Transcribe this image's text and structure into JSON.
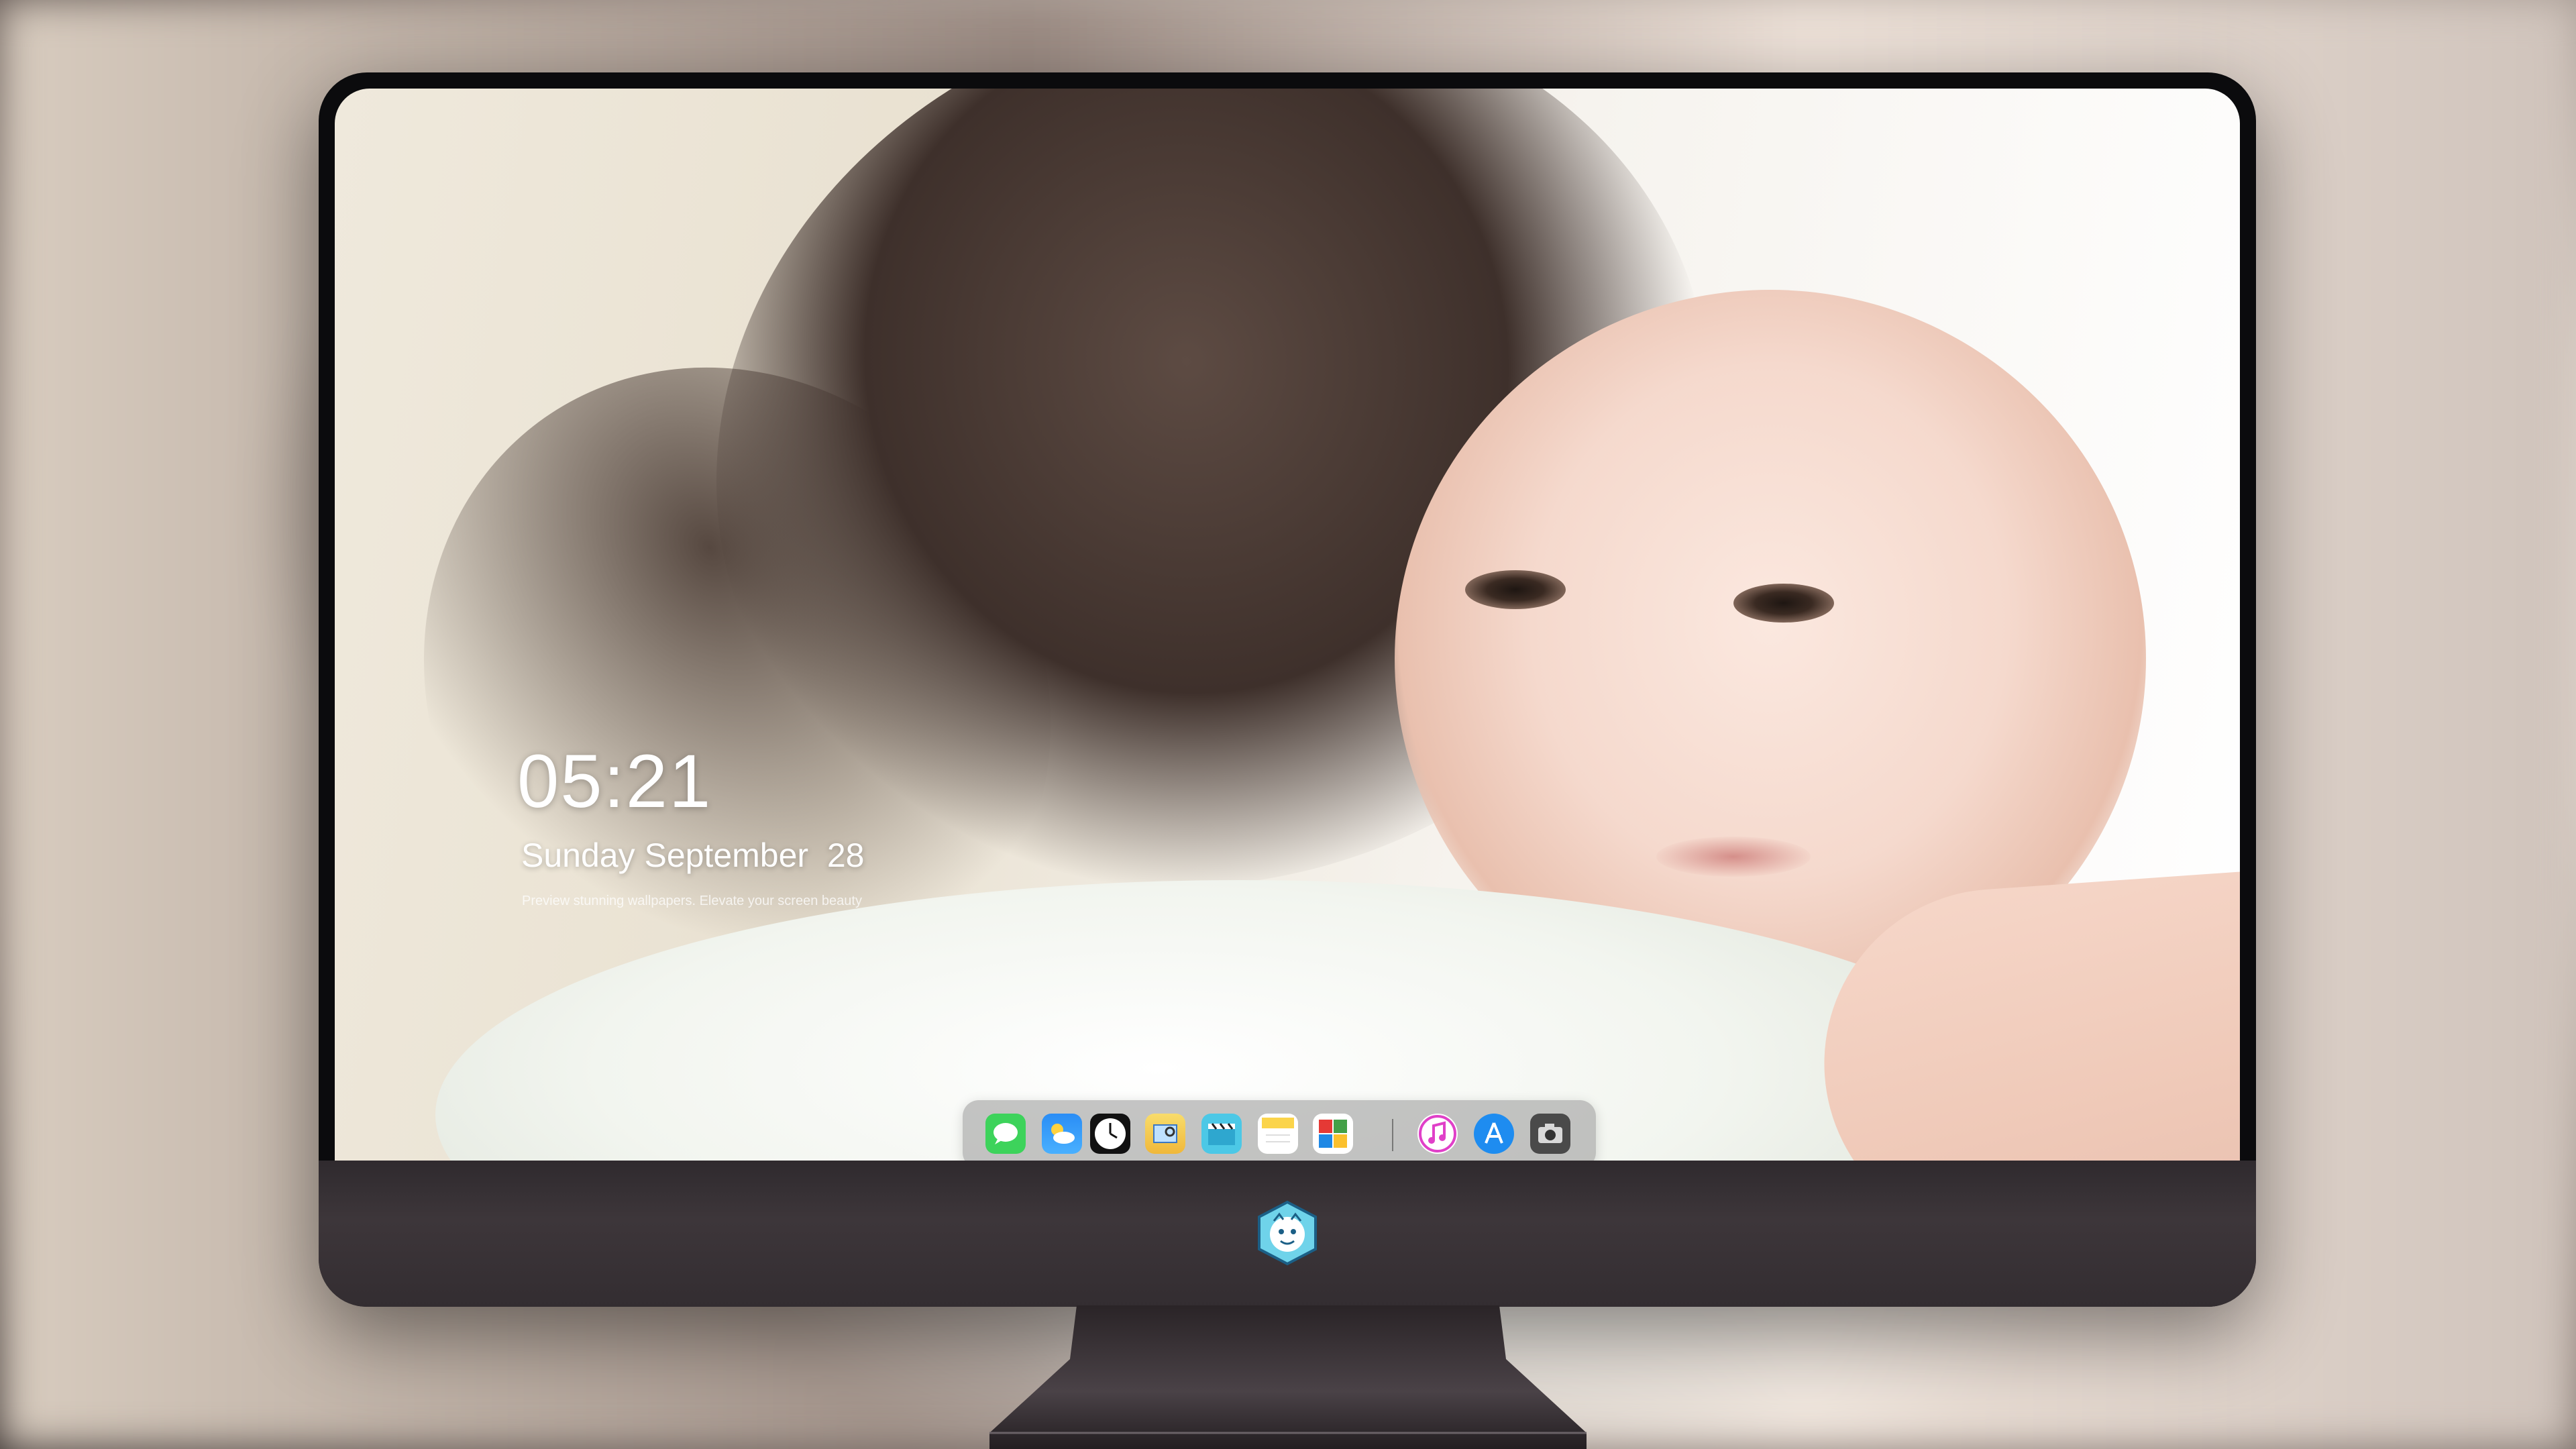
{
  "lockscreen": {
    "time": "05:21",
    "date": "Sunday September  28",
    "caption": "Preview stunning wallpapers. Elevate your screen beauty"
  },
  "dock": {
    "apps": [
      {
        "name": "messages",
        "icon": "chat-bubble-icon",
        "color": "#3dd35b"
      },
      {
        "name": "weather",
        "icon": "weather-cloud-icon",
        "color": "#2a8df5"
      },
      {
        "name": "clock",
        "icon": "clock-icon",
        "color": "#ffffff"
      },
      {
        "name": "preview",
        "icon": "preview-icon",
        "color": "#f5c843"
      },
      {
        "name": "video",
        "icon": "clapperboard-icon",
        "color": "#4cc8e6"
      },
      {
        "name": "notes",
        "icon": "notes-icon",
        "color": "#fbd44a"
      },
      {
        "name": "photo-booth",
        "icon": "photo-grid-icon",
        "color": "#ffffff"
      },
      {
        "name": "music",
        "icon": "music-note-icon",
        "color": "#e040c8"
      },
      {
        "name": "app-store",
        "icon": "app-store-icon",
        "color": "#1e8cf0"
      },
      {
        "name": "camera",
        "icon": "camera-icon",
        "color": "#5a5a5a"
      }
    ]
  },
  "colors": {
    "bezel": "#0b0b0d",
    "chin": "#3d363a",
    "dock_bg": "#969696"
  }
}
